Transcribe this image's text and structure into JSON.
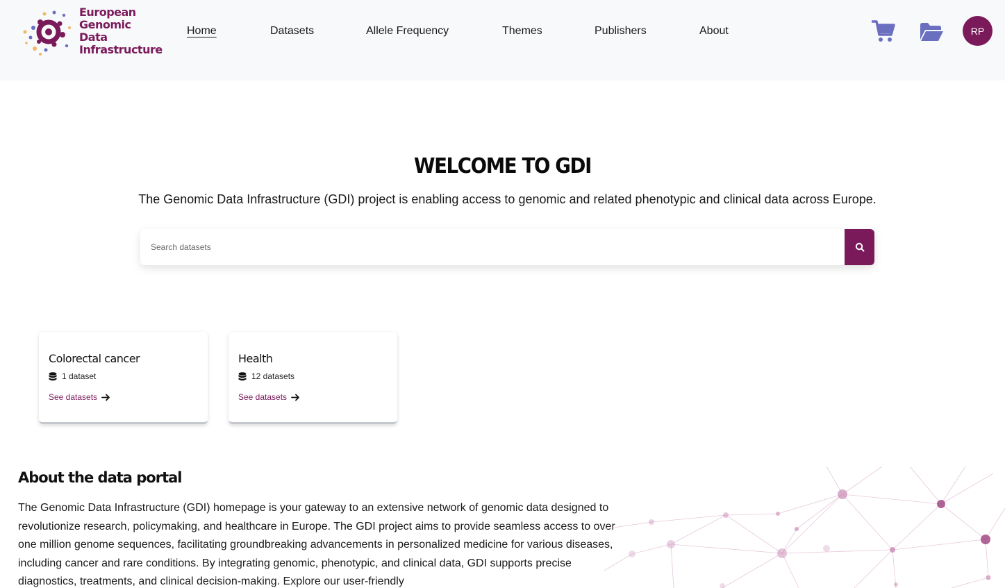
{
  "header": {
    "logo_text": [
      "European",
      "Genomic Data",
      "Infrastructure"
    ],
    "nav": [
      {
        "label": "Home",
        "active": true
      },
      {
        "label": "Datasets"
      },
      {
        "label": "Allele Frequency"
      },
      {
        "label": "Themes"
      },
      {
        "label": "Publishers"
      },
      {
        "label": "About"
      }
    ],
    "icons": [
      "shopping-cart-icon",
      "folder-open-icon"
    ],
    "avatar_initials": "RP"
  },
  "hero": {
    "title": "WELCOME TO GDI",
    "subtitle": "The Genomic Data Infrastructure (GDI) project is enabling access to genomic and related phenotypic and clinical data across Europe."
  },
  "search": {
    "placeholder": "Search datasets"
  },
  "themes": [
    {
      "title": "Colorectal cancer",
      "count": "1 dataset",
      "link": "See datasets"
    },
    {
      "title": "Health",
      "count": "12 datasets",
      "link": "See datasets"
    }
  ],
  "about": {
    "title": "About the data portal",
    "text": "The Genomic Data Infrastructure (GDI) homepage is your gateway to an extensive network of genomic data designed to revolutionize research, policymaking, and healthcare in Europe. The GDI project aims to provide seamless access to over one million genome sequences, facilitating groundbreaking advancements in personalized medicine for various diseases, including cancer and rare conditions. By integrating genomic, phenotypic, and clinical data, GDI supports precise diagnostics, treatments, and clinical decision-making. Explore our user-friendly"
  },
  "colors": {
    "brand": "#7a1a5a",
    "icon_accent": "#6a6fbf",
    "header_bg": "#f8f9fb"
  }
}
